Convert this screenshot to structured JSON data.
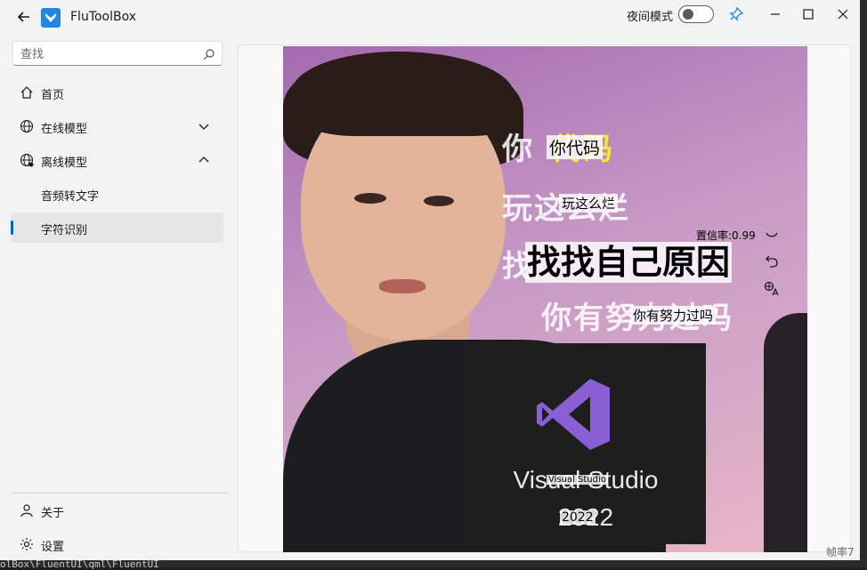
{
  "app": {
    "title": "FluToolBox"
  },
  "titlebar": {
    "night_mode_label": "夜间模式"
  },
  "search": {
    "placeholder": "查找"
  },
  "nav": {
    "home": "首页",
    "online_models": "在线模型",
    "offline_models": "离线模型",
    "audio_to_text": "音频转文字",
    "ocr": "字符识别",
    "about": "关于",
    "settings": "设置"
  },
  "image": {
    "captions": [
      "你",
      "代码",
      "玩这么烂",
      "找",
      "你有努力过吗"
    ],
    "vs_title": "Visual Studio",
    "vs_year": "2022"
  },
  "ocr_results": [
    {
      "text": "你代码"
    },
    {
      "text": "玩这么烂"
    },
    {
      "text": "找找自己原因"
    },
    {
      "text": "你有努力过吗"
    },
    {
      "text": "Visual Studio"
    },
    {
      "text": "2022"
    }
  ],
  "confidence_label": "置信率:0.99",
  "fps_label": "帧率7",
  "bottom_path": "olBox\\FluentUI\\qml\\FluentUI",
  "colors": {
    "accent": "#0067c0",
    "logo": "#1e88e5",
    "vs_purple": "#8a5fd4"
  },
  "icons": [
    "back-arrow-icon",
    "app-logo-icon",
    "pin-icon",
    "minimize-icon",
    "maximize-icon",
    "close-icon",
    "search-icon",
    "home-icon",
    "globe-icon",
    "globe-offline-icon",
    "chevron-down-icon",
    "chevron-up-icon",
    "user-icon",
    "gear-icon",
    "undo-icon",
    "translate-icon",
    "smile-icon"
  ]
}
